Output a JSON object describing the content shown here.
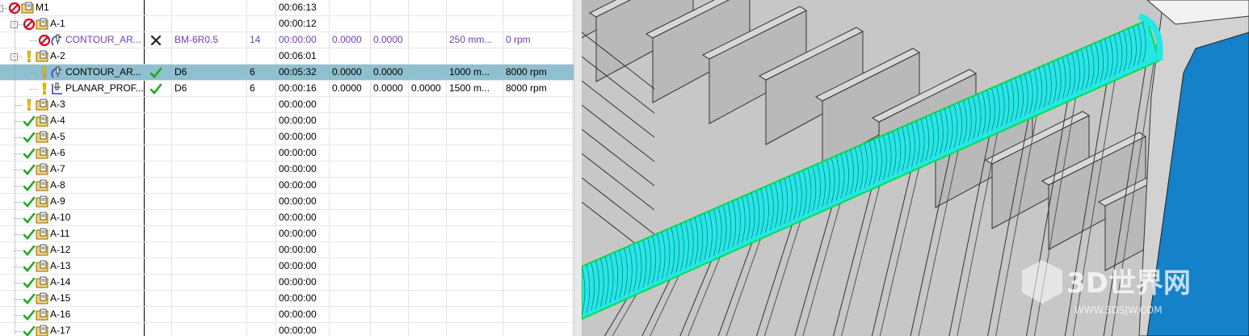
{
  "tree": {
    "rows": [
      {
        "depth": 0,
        "status": "error",
        "type": "folder",
        "name": "M1",
        "cols": [
          "",
          "",
          "",
          "00:06:13",
          "",
          "",
          "",
          "",
          ""
        ],
        "expand": "-"
      },
      {
        "depth": 1,
        "status": "error",
        "type": "folder",
        "name": "A-1",
        "cols": [
          "",
          "",
          "",
          "00:00:12",
          "",
          "",
          "",
          "",
          ""
        ],
        "expand": "-"
      },
      {
        "depth": 2,
        "status": "error",
        "type": "contour",
        "name": "CONTOUR_AR...",
        "purple": true,
        "check": "x",
        "cols": [
          "BM-6R0.5",
          "14",
          "00:00:00",
          "0.0000",
          "0.0000",
          "",
          "250 mm...",
          "0 rpm"
        ]
      },
      {
        "depth": 1,
        "status": "warn",
        "type": "folder",
        "name": "A-2",
        "cols": [
          "",
          "",
          "",
          "00:06:01",
          "",
          "",
          "",
          "",
          ""
        ],
        "expand": "-"
      },
      {
        "depth": 2,
        "status": "warn",
        "type": "contour",
        "name": "CONTOUR_AR...",
        "selected": true,
        "check": "ok",
        "cols": [
          "D6",
          "6",
          "00:05:32",
          "0.0000",
          "0.0000",
          "",
          "1000 m...",
          "8000 rpm"
        ]
      },
      {
        "depth": 2,
        "status": "warn",
        "type": "planar",
        "name": "PLANAR_PROF...",
        "check": "ok",
        "cols": [
          "D6",
          "6",
          "00:00:16",
          "0.0000",
          "0.0000",
          "0.0000",
          "1500 m...",
          "8000 rpm"
        ]
      },
      {
        "depth": 1,
        "status": "warn",
        "type": "folder",
        "name": "A-3",
        "cols": [
          "",
          "",
          "",
          "00:00:00"
        ]
      },
      {
        "depth": 1,
        "status": "ok",
        "type": "folder",
        "name": "A-4",
        "cols": [
          "",
          "",
          "",
          "00:00:00"
        ]
      },
      {
        "depth": 1,
        "status": "ok",
        "type": "folder",
        "name": "A-5",
        "cols": [
          "",
          "",
          "",
          "00:00:00"
        ]
      },
      {
        "depth": 1,
        "status": "ok",
        "type": "folder",
        "name": "A-6",
        "cols": [
          "",
          "",
          "",
          "00:00:00"
        ]
      },
      {
        "depth": 1,
        "status": "ok",
        "type": "folder",
        "name": "A-7",
        "cols": [
          "",
          "",
          "",
          "00:00:00"
        ]
      },
      {
        "depth": 1,
        "status": "ok",
        "type": "folder",
        "name": "A-8",
        "cols": [
          "",
          "",
          "",
          "00:00:00"
        ]
      },
      {
        "depth": 1,
        "status": "ok",
        "type": "folder",
        "name": "A-9",
        "cols": [
          "",
          "",
          "",
          "00:00:00"
        ]
      },
      {
        "depth": 1,
        "status": "ok",
        "type": "folder",
        "name": "A-10",
        "cols": [
          "",
          "",
          "",
          "00:00:00"
        ]
      },
      {
        "depth": 1,
        "status": "ok",
        "type": "folder",
        "name": "A-11",
        "cols": [
          "",
          "",
          "",
          "00:00:00"
        ]
      },
      {
        "depth": 1,
        "status": "ok",
        "type": "folder",
        "name": "A-12",
        "cols": [
          "",
          "",
          "",
          "00:00:00"
        ]
      },
      {
        "depth": 1,
        "status": "ok",
        "type": "folder",
        "name": "A-13",
        "cols": [
          "",
          "",
          "",
          "00:00:00"
        ]
      },
      {
        "depth": 1,
        "status": "ok",
        "type": "folder",
        "name": "A-14",
        "cols": [
          "",
          "",
          "",
          "00:00:00"
        ]
      },
      {
        "depth": 1,
        "status": "ok",
        "type": "folder",
        "name": "A-15",
        "cols": [
          "",
          "",
          "",
          "00:00:00"
        ]
      },
      {
        "depth": 1,
        "status": "ok",
        "type": "folder",
        "name": "A-16",
        "cols": [
          "",
          "",
          "",
          "00:00:00"
        ]
      },
      {
        "depth": 1,
        "status": "ok",
        "type": "folder",
        "name": "A-17",
        "cols": [
          "",
          "",
          "",
          "00:00:00"
        ]
      }
    ]
  },
  "viewport": {
    "watermark_text": "3D世界网",
    "watermark_url": "WWW.3DSJW.COM",
    "colors": {
      "toolpath": "#27e6e6",
      "toolpath_edge": "#00e04a",
      "stock": "#c4c4c4",
      "fixture": "#1581c9",
      "selection": "#8fc0cf"
    }
  }
}
